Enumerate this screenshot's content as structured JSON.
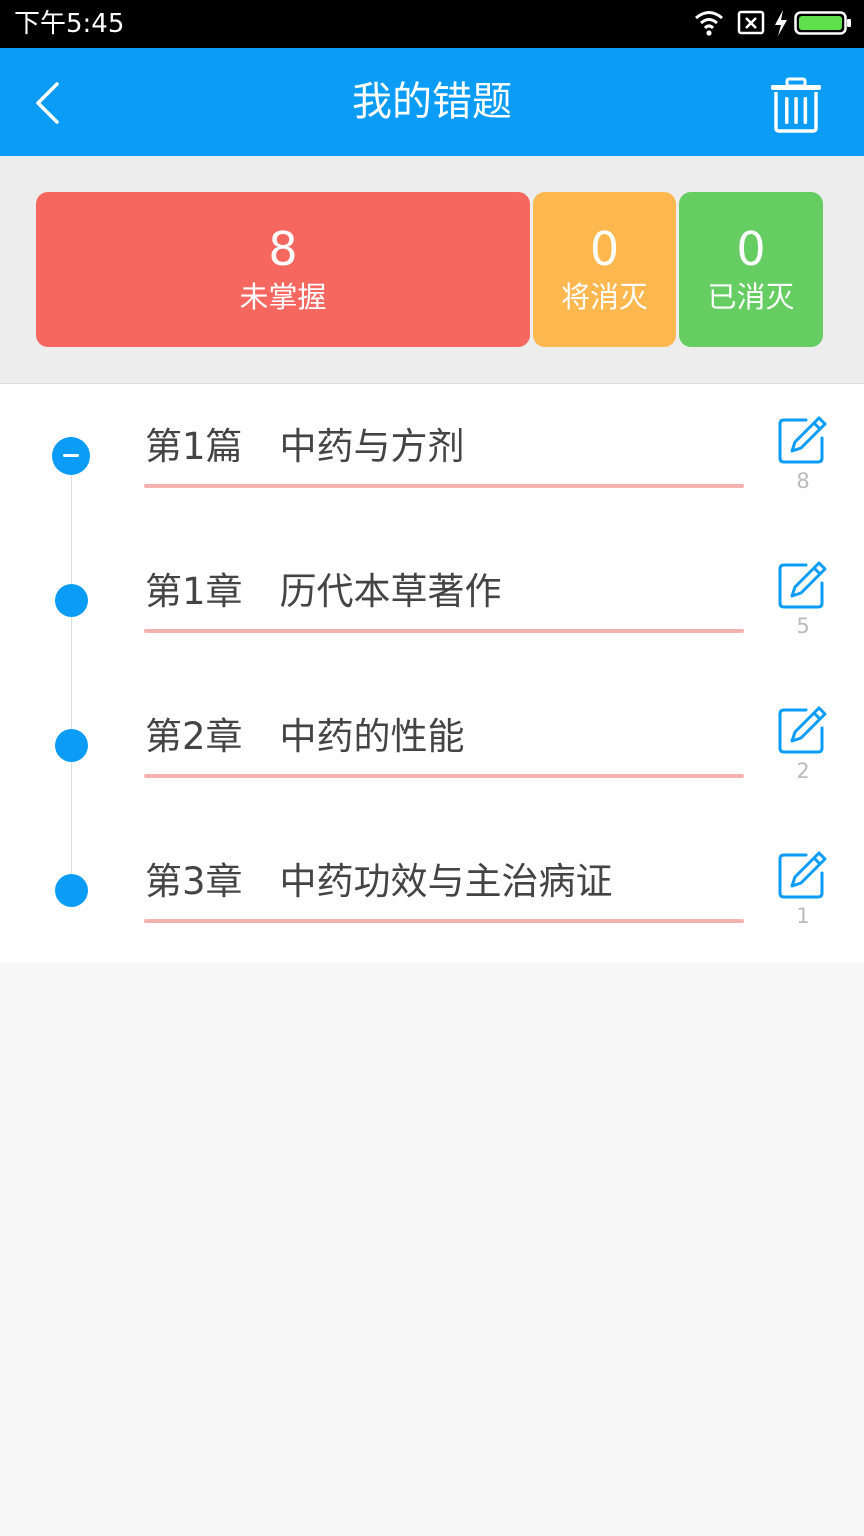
{
  "status_bar": {
    "time": "下午5:45",
    "icons": [
      "wifi-icon",
      "sim-off-icon",
      "charging-icon",
      "battery-icon"
    ]
  },
  "header": {
    "title": "我的错题",
    "back_icon": "chevron-left-icon",
    "delete_icon": "trash-icon"
  },
  "stats": [
    {
      "value": "8",
      "label": "未掌握",
      "color": "#f5675f"
    },
    {
      "value": "0",
      "label": "将消灭",
      "color": "#ffb74f"
    },
    {
      "value": "0",
      "label": "已消灭",
      "color": "#66cd63"
    }
  ],
  "tree": [
    {
      "title": "第1篇　中药与方剂",
      "count": "8",
      "node": "collapse"
    },
    {
      "title": "第1章　历代本草著作",
      "count": "5",
      "node": "dot"
    },
    {
      "title": "第2章　中药的性能",
      "count": "2",
      "node": "dot"
    },
    {
      "title": "第3章　中药功效与主治病证",
      "count": "1",
      "node": "dot"
    }
  ],
  "colors": {
    "accent": "#0a9cf6",
    "underline": "#f4b3ae"
  }
}
